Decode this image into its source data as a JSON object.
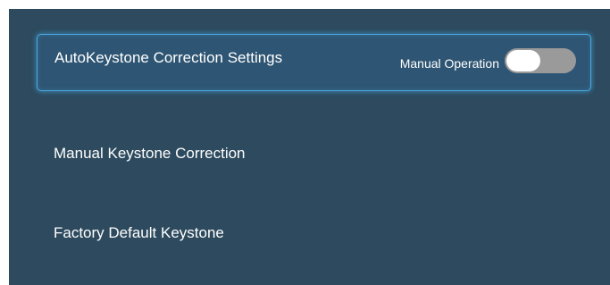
{
  "menu": {
    "items": [
      {
        "label": "AutoKeystone Correction Settings",
        "toggle_caption": "Manual Operation",
        "toggle_on": false
      },
      {
        "label": "Manual Keystone Correction"
      },
      {
        "label": "Factory Default Keystone"
      }
    ]
  },
  "colors": {
    "panel_background": "#2d4a5e",
    "selection_border": "#4aa8e0",
    "toggle_track_off": "#9a9a9a",
    "text": "#ffffff"
  }
}
